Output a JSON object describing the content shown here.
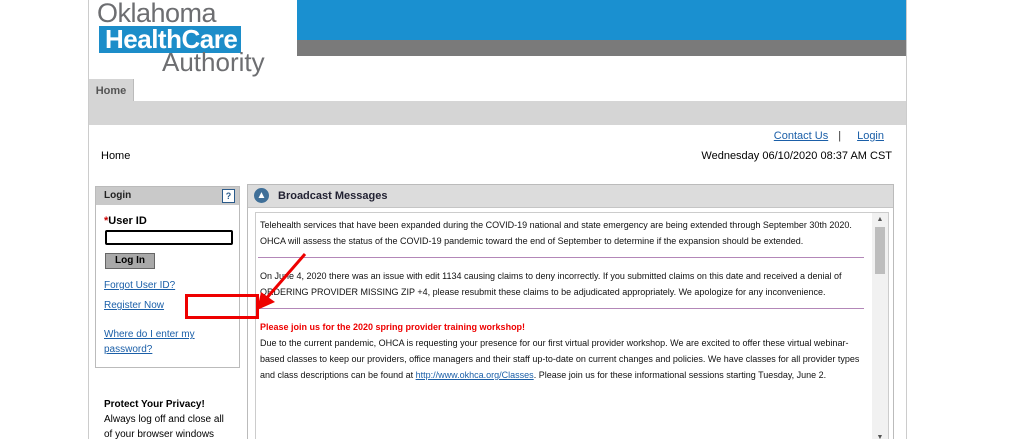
{
  "header": {
    "logo_line1": "Oklahoma",
    "logo_line2": "HealthCare",
    "logo_line3": "Authority"
  },
  "nav": {
    "home_tab": "Home"
  },
  "toplinks": {
    "contact": "Contact Us",
    "separator": "|",
    "login": "Login"
  },
  "breadcrumb": "Home",
  "datetime": "Wednesday 06/10/2020 08:37 AM CST",
  "login_panel": {
    "title": "Login",
    "help": "?",
    "required_mark": "*",
    "user_id_label": "User ID",
    "user_id_value": "",
    "login_button": "Log In",
    "forgot_link": "Forgot User ID?",
    "register_link": "Register Now",
    "where_link": "Where do I enter my password?"
  },
  "privacy": {
    "title": "Protect Your Privacy!",
    "text": "Always log off and close all of your browser windows"
  },
  "broadcast": {
    "title": "Broadcast Messages",
    "messages": [
      "Telehealth services that have been expanded during the COVID-19 national and state emergency are being extended through September 30th 2020.  OHCA will assess the status of the COVID-19 pandemic toward the end of September to determine if the expansion should be extended.",
      "On June 4, 2020 there was an issue with edit 1134 causing claims to deny incorrectly. If you submitted claims on this date and received a denial of ORDERING PROVIDER MISSING ZIP +4, please resubmit these claims to be adjudicated appropriately. We apologize for any inconvenience."
    ],
    "workshop_title": "Please join us for the 2020 spring provider training workshop!",
    "workshop_text": "Due to the current pandemic, OHCA is requesting your presence for our first virtual provider workshop. We are excited to offer these virtual webinar-based classes to keep our providers, office managers and their staff up-to-date on current changes and policies. We have classes for all provider types and class descriptions can be found at",
    "workshop_link": "http://www.okhca.org/Classes",
    "workshop_tail": ". Please join us for these informational sessions starting Tuesday, June 2."
  },
  "colors": {
    "brand_blue": "#1a90d0",
    "link": "#1b5fa8",
    "annotation_red": "#e00000"
  }
}
